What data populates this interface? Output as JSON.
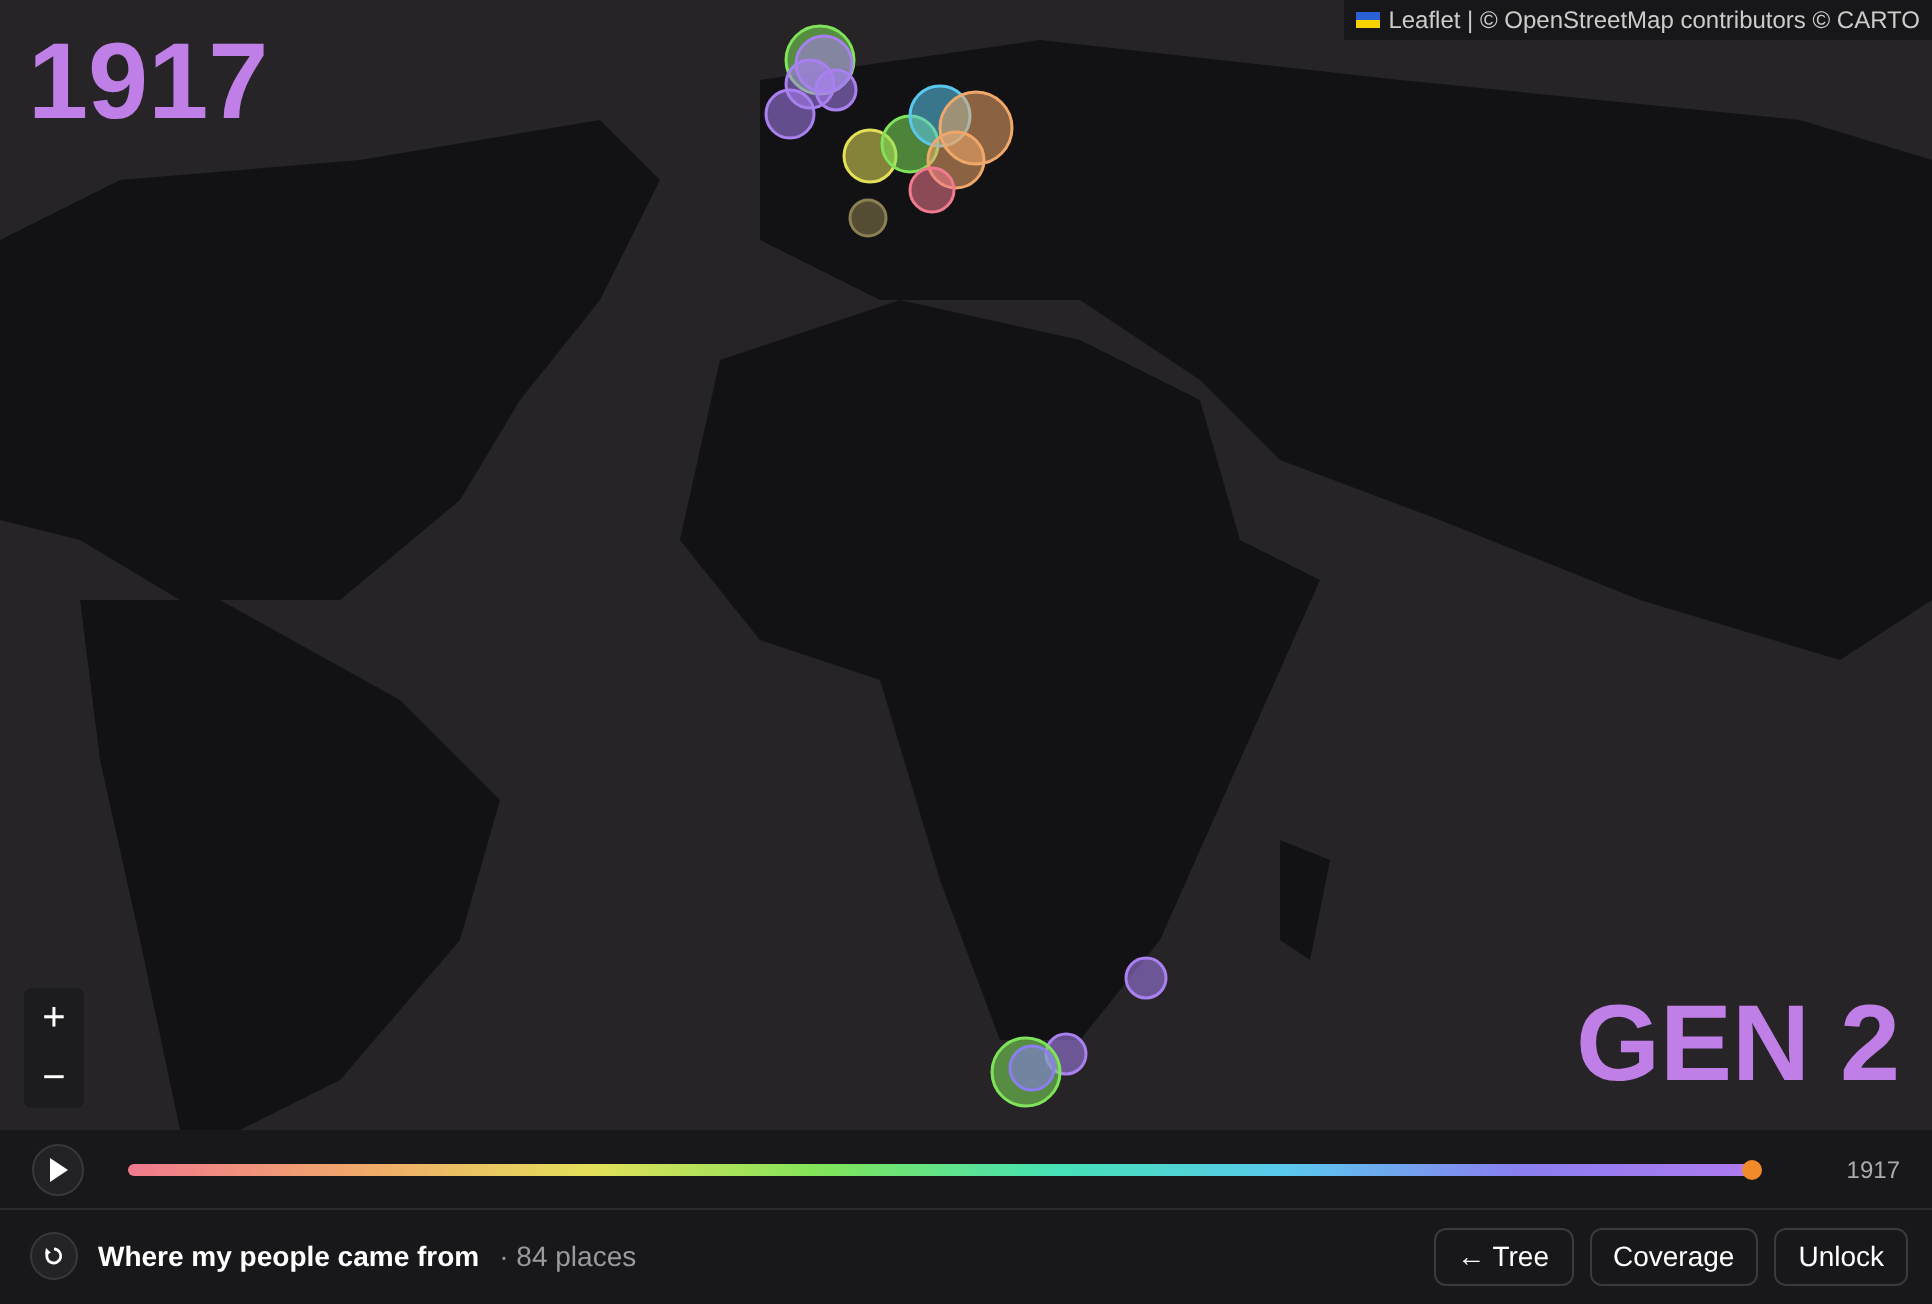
{
  "map": {
    "year": "1917",
    "attribution": "Leaflet | © OpenStreetMap contributors © CARTO",
    "zoom_buttons": [
      "+",
      "−"
    ],
    "generation": "GEN 2"
  },
  "timeline": {
    "level": 1,
    "year": "1917"
  },
  "footer": {
    "title": "Where my people came from",
    "count": "· 84 places",
    "buttons": [
      "← Tree",
      "Coverage",
      "Unlock"
    ]
  }
}
